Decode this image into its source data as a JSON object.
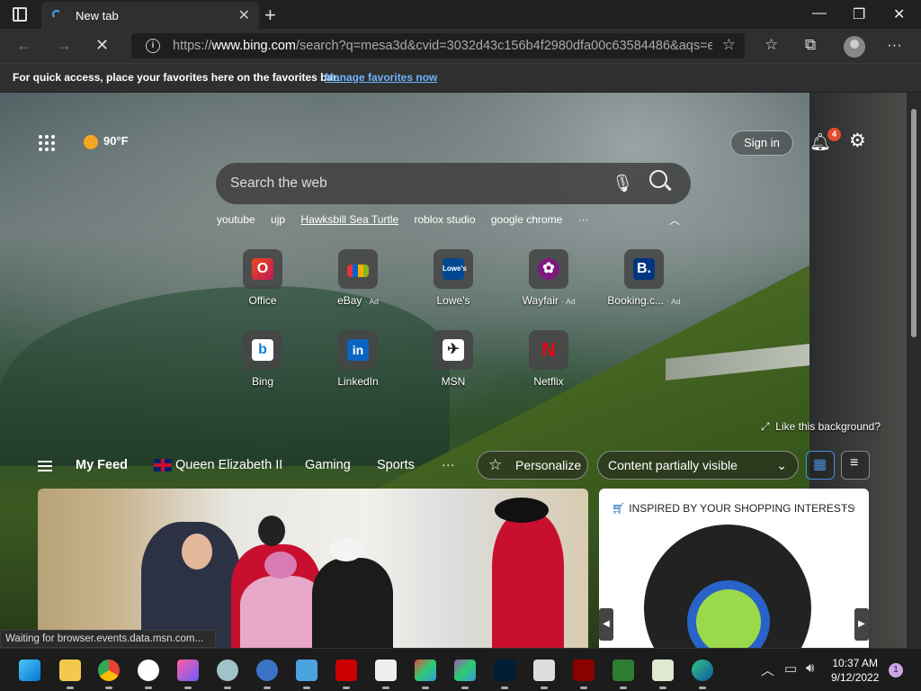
{
  "window": {
    "tab_title": "New tab",
    "new_tab_symbol": "+",
    "close_tab_symbol": "✕",
    "min_symbol": "—",
    "max_symbol": "❐",
    "close_symbol": "✕"
  },
  "toolbar": {
    "back_symbol": "←",
    "forward_symbol": "→",
    "stop_symbol": "✕",
    "url_scheme": "https://",
    "url_host": "www.bing.com",
    "url_rest": "/search?q=mesa3d&cvid=3032d43c156b4f2980dfa00c63584486&aqs=e...",
    "more_symbol": "···"
  },
  "favorites_bar": {
    "message": "For quick access, place your favorites here on the favorites bar.",
    "link": "Manage favorites now"
  },
  "ntp": {
    "weather": "90°F",
    "sign_in": "Sign in",
    "notification_count": "4",
    "search_placeholder": "Search the web",
    "trending": [
      "youtube",
      "ujp",
      "Hawksbill Sea Turtle",
      "roblox studio",
      "google chrome",
      "···"
    ],
    "chevron": "︿",
    "tiles_row1": [
      {
        "label": "Office",
        "ad": ""
      },
      {
        "label": "eBay",
        "ad": "· Ad"
      },
      {
        "label": "Lowe's",
        "ad": ""
      },
      {
        "label": "Wayfair",
        "ad": "· Ad"
      },
      {
        "label": "Booking.c...",
        "ad": "· Ad"
      }
    ],
    "tiles_row2": [
      {
        "label": "Bing"
      },
      {
        "label": "LinkedIn"
      },
      {
        "label": "MSN"
      },
      {
        "label": "Netflix"
      }
    ],
    "like_background": "Like this background?"
  },
  "feed": {
    "items": [
      "My Feed",
      "Queen Elizabeth II",
      "Gaming",
      "Sports",
      "···"
    ],
    "personalize": "Personalize",
    "content_visibility": "Content partially visible",
    "shopping_header": "INSPIRED BY YOUR SHOPPING INTERESTS",
    "shopping_more": "···"
  },
  "status": {
    "text": "Waiting for browser.events.data.msn.com..."
  },
  "taskbar": {
    "time": "10:37 AM",
    "date": "9/12/2022",
    "notification_count": "1"
  },
  "colors": {
    "accent": "#4aa3ff",
    "badge": "#e34b2c",
    "link": "#6fb3ff"
  }
}
